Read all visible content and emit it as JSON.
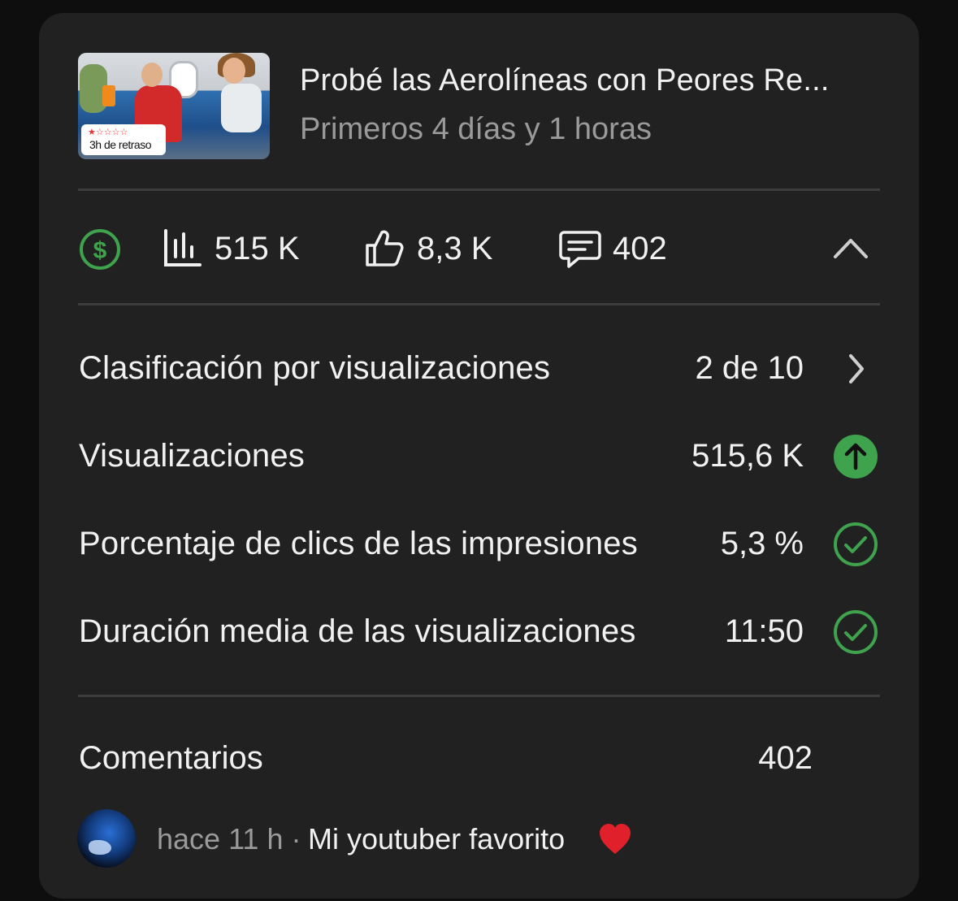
{
  "video": {
    "title": "Probé las Aerolíneas con Peores Re...",
    "period": "Primeros 4 días y 1 horas",
    "thumbnail_badge": "3h de retraso"
  },
  "stats": {
    "views": "515 K",
    "likes": "8,3 K",
    "comments": "402",
    "icons": [
      "dollar-circle-icon",
      "bar-chart-icon",
      "thumbs-up-icon",
      "comment-icon",
      "chevron-up-icon"
    ]
  },
  "metrics": [
    {
      "label": "Clasificación por visualizaciones",
      "value": "2 de 10",
      "icon": "chevron-right-icon"
    },
    {
      "label": "Visualizaciones",
      "value": "515,6 K",
      "icon": "arrow-up-circle-icon"
    },
    {
      "label": "Porcentaje de clics de las impresiones",
      "value": "5,3 %",
      "icon": "check-circle-icon"
    },
    {
      "label": "Duración media de las visualizaciones",
      "value": "11:50",
      "icon": "check-circle-icon"
    }
  ],
  "comments_section": {
    "label": "Comentarios",
    "count": "402",
    "latest": {
      "time": "hace 11 h ·",
      "text": "Mi youtuber favorito",
      "emoji": "heart-icon"
    }
  },
  "colors": {
    "background": "#212121",
    "accent_green": "#3fa34d",
    "text_primary": "#f1f1f1",
    "text_secondary": "#9a9a9a"
  }
}
